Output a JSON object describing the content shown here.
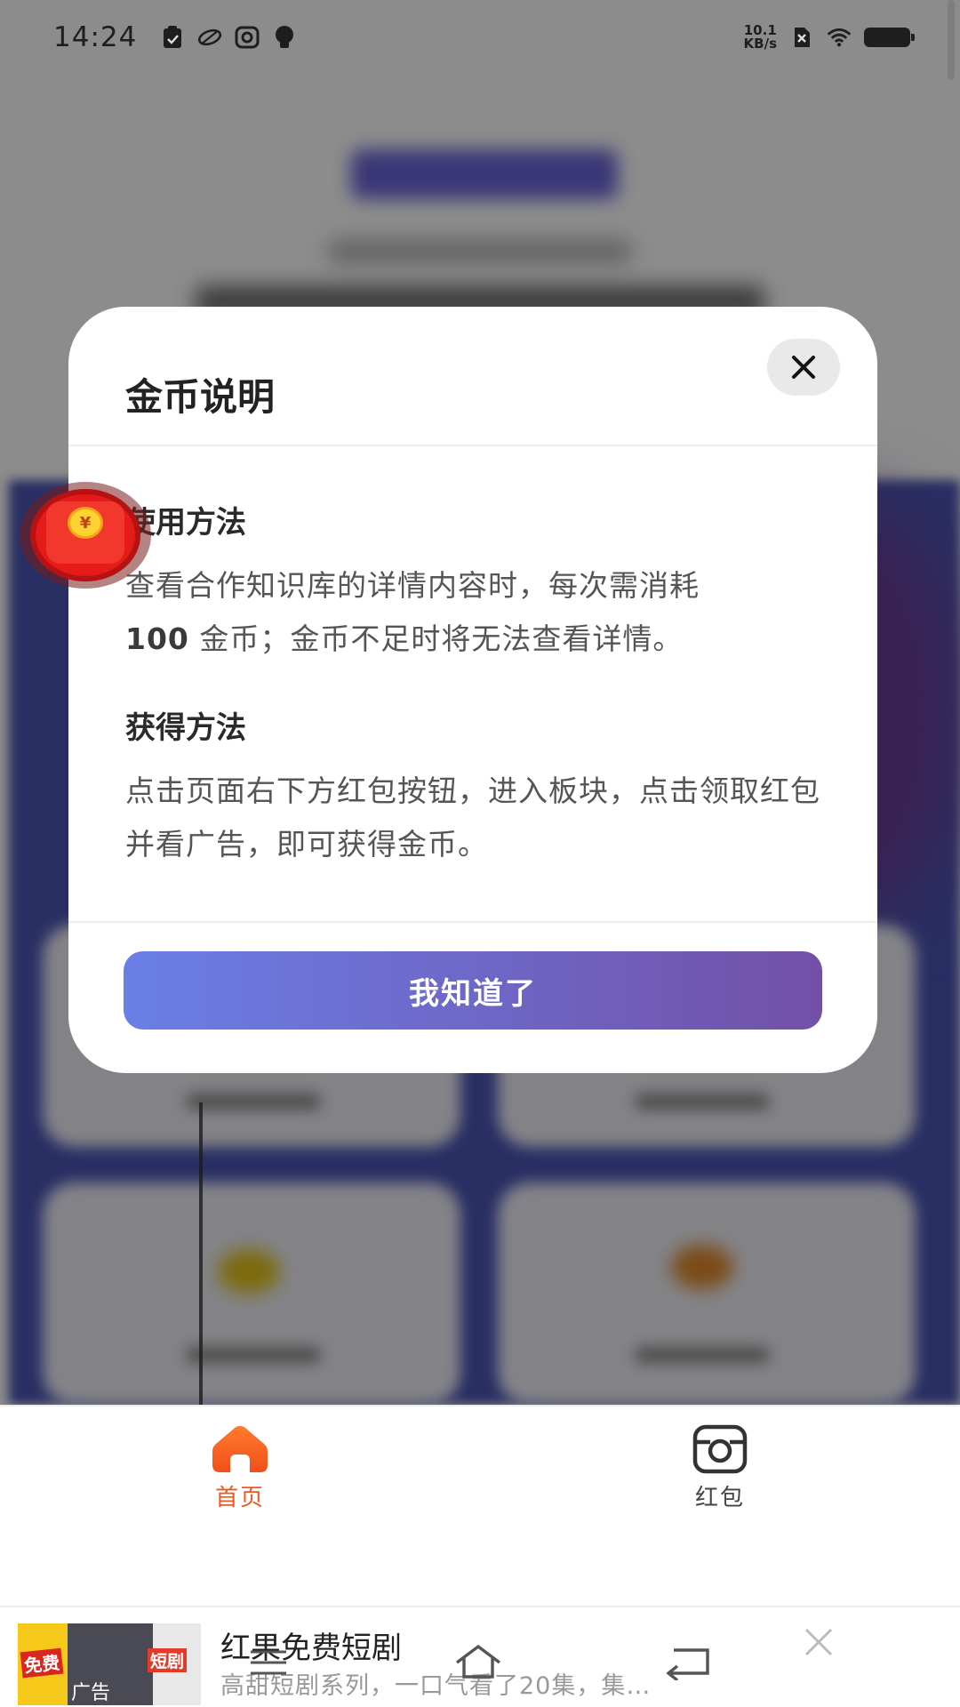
{
  "status_bar": {
    "time": "14:24",
    "net_speed_value": "10.1",
    "net_speed_unit": "KB/s"
  },
  "modal": {
    "title": "金币说明",
    "usage": {
      "title": "使用方法",
      "text_prefix": "查看合作知识库的详情内容时，每次需消耗",
      "amount": "100",
      "text_suffix": " 金币；金币不足时将无法查看详情。"
    },
    "earn": {
      "title": "获得方法",
      "text": "点击页面右下方红包按钮，进入板块，点击领取红包并看广告，即可获得金币。"
    },
    "confirm_label": "我知道了",
    "accent_gradient": [
      "#6a7fe6",
      "#7250a8"
    ]
  },
  "floating_envelope": {
    "coin_symbol": "¥"
  },
  "tab_bar": {
    "tabs": [
      {
        "label": "首页",
        "icon": "home-icon",
        "active": true,
        "color": "#f2571e"
      },
      {
        "label": "红包",
        "icon": "camera-icon",
        "active": false,
        "color": "#444444"
      }
    ]
  },
  "ad": {
    "title": "红果免费短剧",
    "description": "高甜短剧系列，一口气看了20集，集…",
    "thumb_tag_free": "免费",
    "thumb_tag_drama": "短剧",
    "thumb_tag_ad": "广告"
  }
}
